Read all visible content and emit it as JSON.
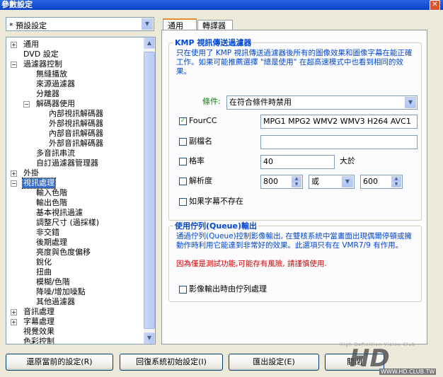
{
  "window": {
    "title": "參數設定",
    "close": "✕"
  },
  "preset": {
    "value": "* 預設設定"
  },
  "tree": {
    "items": [
      {
        "label": "通用",
        "pm": "+"
      },
      {
        "label": "DVD 設定",
        "pm": ""
      },
      {
        "label": "過濾器控制",
        "pm": "−"
      },
      {
        "label": "無縫播放",
        "pm": ""
      },
      {
        "label": "來源過濾器",
        "pm": ""
      },
      {
        "label": "分離器",
        "pm": ""
      },
      {
        "label": "解碼器使用",
        "pm": "−"
      },
      {
        "label": "內部視訊解碼器",
        "pm": ""
      },
      {
        "label": "外部視訊解碼器",
        "pm": ""
      },
      {
        "label": "內部音訊解碼器",
        "pm": ""
      },
      {
        "label": "外部音訊解碼器",
        "pm": ""
      },
      {
        "label": "多音訊串流",
        "pm": ""
      },
      {
        "label": "自訂過濾器管理器",
        "pm": ""
      },
      {
        "label": "外掛",
        "pm": "+"
      },
      {
        "label": "視訊處理",
        "pm": "−"
      },
      {
        "label": "輸入色階",
        "pm": ""
      },
      {
        "label": "輸出色階",
        "pm": ""
      },
      {
        "label": "基本視訊過濾",
        "pm": ""
      },
      {
        "label": "調整尺寸 (過採樣)",
        "pm": ""
      },
      {
        "label": "非交錯",
        "pm": ""
      },
      {
        "label": "後期處理",
        "pm": ""
      },
      {
        "label": "亮度與色度偏移",
        "pm": ""
      },
      {
        "label": "銳化",
        "pm": ""
      },
      {
        "label": "扭曲",
        "pm": ""
      },
      {
        "label": "模糊/色階",
        "pm": ""
      },
      {
        "label": "降噪/增加噪點",
        "pm": ""
      },
      {
        "label": "其他過濾器",
        "pm": ""
      },
      {
        "label": "音訊處理",
        "pm": "+"
      },
      {
        "label": "字幕處理",
        "pm": "+"
      },
      {
        "label": "視覺效果",
        "pm": ""
      },
      {
        "label": "色彩控制",
        "pm": ""
      }
    ]
  },
  "tabs": {
    "general": "通用",
    "converter": "轉譯器"
  },
  "kmp_group": {
    "title": "KMP 視訊傳送過濾器",
    "desc": "只在使用了 KMP 視訊傳送過濾器後所有的圖像效果和圖像字幕在能正確工作。如果可能推薦選擇 \"總是使用\" 在超高速模式中也看到相同的效果。",
    "condition_label": "條件:",
    "condition_value": "在符合條件時禁用",
    "fourcc_label": "FourCC",
    "fourcc_value": "MPG1 MPG2 WMV2 WMV3 H264 AVC1",
    "ext_label": "副檔名",
    "ext_value": "",
    "fps_label": "格率",
    "fps_value": "40",
    "fps_suffix": "大於",
    "res_label": "解析度",
    "res_w": "800",
    "res_op": "或",
    "res_h": "600",
    "nosub_label": "如果字幕不存在"
  },
  "queue_group": {
    "title": "使用佇列(Queue)輸出",
    "desc": "通過佇列(Queue)控制影像輸出, 在雙核系統中當畫面出現偶爾停頓或擁動作時利用它能達到非常好的效果。此選項只有在 VMR7/9 有作用。",
    "warn": "因為僅是測試功能,可能存有風險, 請謹慎使用.",
    "check_label": "影像輸出時由佇列處理"
  },
  "buttons": {
    "restore": "還原當前的設定(R)",
    "reset": "回復系統初始設定(I)",
    "export": "匯出設定(E)",
    "close": "關閉"
  },
  "watermark": {
    "site": "WWW.HD.CLUB.TW",
    "brand": "HD",
    "tag": "High Definition Vision Club"
  }
}
